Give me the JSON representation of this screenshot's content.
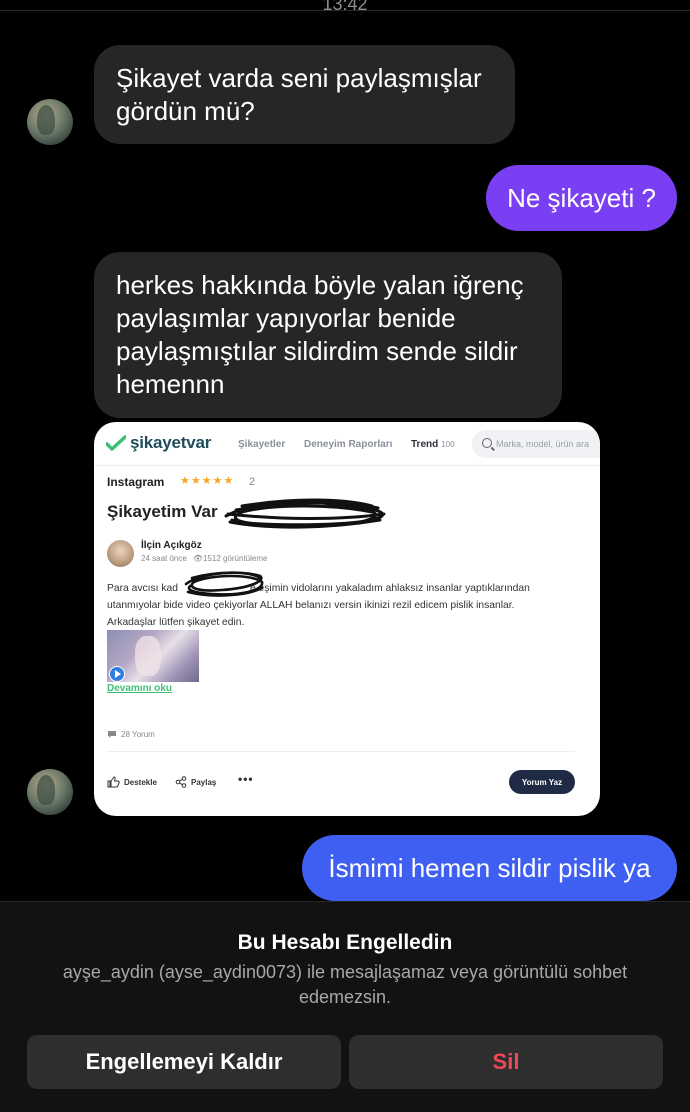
{
  "status": {
    "time": "13:42"
  },
  "messages": {
    "m1": "Şikayet varda seni paylaşmışlar gördün mü?",
    "m2": "Ne şikayeti ?",
    "m3": "herkes hakkında böyle yalan iğrenç paylaşımlar yapıyorlar benide paylaşmıştılar sildirdim sende sildir hemennn",
    "m4": "İsmimi hemen sildir pislik ya"
  },
  "shared_screenshot": {
    "logo": "şikayetvar",
    "nav": {
      "complaints": "Şikayetler",
      "reports": "Deneyim Raporları",
      "trend": "Trend",
      "trend_count": "100"
    },
    "search_placeholder": "Marka, model, ürün ara",
    "brand": "Instagram",
    "stars": "★★★★★",
    "rating": "2",
    "title": "Şikayetim Var",
    "author": "İlçin Açıkgöz",
    "time_ago": "24 saat önce",
    "views": "1512 görüntüleme",
    "body_line1_start": "Para avcısı kad",
    "body_line1_end": "e eşimin vidolarını yakaladım ahlaksız insanlar yaptıklarından",
    "body_line2": "utanmıyolar bide video çekiyorlar ALLAH belanızı versin ikinizi rezil edicem pislik insanlar.",
    "body_line3": "Arkadaşlar lütfen şikayet edin.",
    "read_more": "Devamını oku",
    "comments": "28 Yorum",
    "support": "Destekle",
    "share": "Paylaş",
    "more": "•••",
    "reply": "Yorum Yaz"
  },
  "block_panel": {
    "title": "Bu Hesabı Engelledin",
    "description": "ayşe_aydin (ayse_aydin0073) ile mesajlaşamaz veya görüntülü sohbet edemezsin.",
    "unblock_label": "Engellemeyi Kaldır",
    "delete_label": "Sil"
  },
  "colors": {
    "bubble_in": "#262626",
    "bubble_purple": "#7a3ff2",
    "bubble_blue": "#3f5ff2",
    "delete_red": "#ed4956"
  }
}
